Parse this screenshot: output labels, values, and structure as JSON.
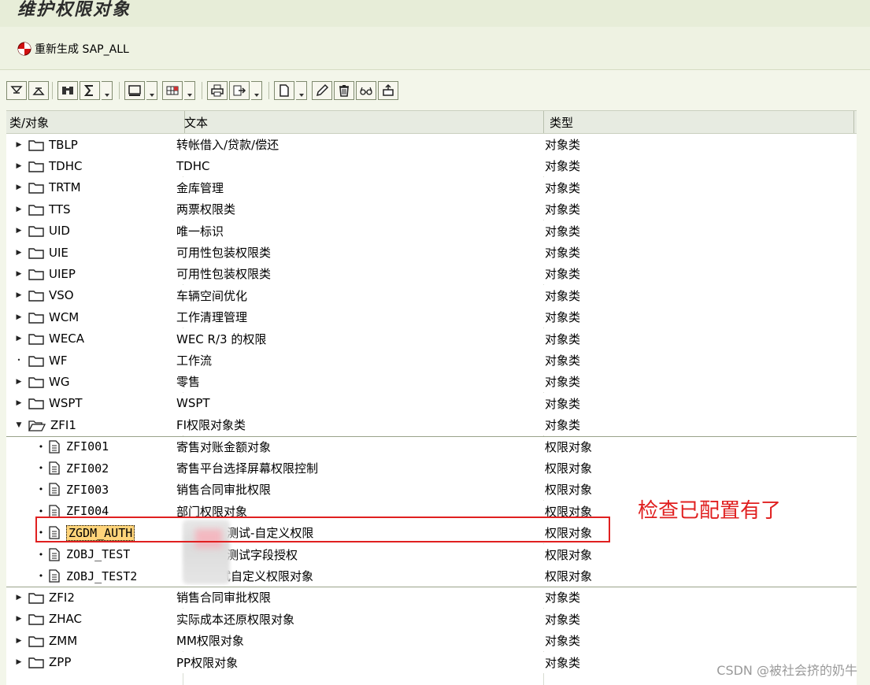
{
  "window": {
    "title": "维护权限对象"
  },
  "app_toolbar": {
    "regenerate_label": "重新生成 SAP_ALL"
  },
  "columns": {
    "class_object": "类/对象",
    "text": "文本",
    "type": "类型"
  },
  "rows": [
    {
      "kind": "class",
      "expander": "collapsed",
      "name": "TBLP",
      "text": "转帐借入/贷款/偿还",
      "type": "对象类"
    },
    {
      "kind": "class",
      "expander": "collapsed",
      "name": "TDHC",
      "text": "TDHC",
      "type": "对象类"
    },
    {
      "kind": "class",
      "expander": "collapsed",
      "name": "TRTM",
      "text": "金库管理",
      "type": "对象类"
    },
    {
      "kind": "class",
      "expander": "collapsed",
      "name": "TTS",
      "text": "两票权限类",
      "type": "对象类"
    },
    {
      "kind": "class",
      "expander": "collapsed",
      "name": "UID",
      "text": "唯一标识",
      "type": "对象类"
    },
    {
      "kind": "class",
      "expander": "collapsed",
      "name": "UIE",
      "text": "可用性包装权限类",
      "type": "对象类"
    },
    {
      "kind": "class",
      "expander": "collapsed",
      "name": "UIEP",
      "text": "可用性包装权限类",
      "type": "对象类"
    },
    {
      "kind": "class",
      "expander": "collapsed",
      "name": "VSO",
      "text": "车辆空间优化",
      "type": "对象类"
    },
    {
      "kind": "class",
      "expander": "collapsed",
      "name": "WCM",
      "text": "工作清理管理",
      "type": "对象类"
    },
    {
      "kind": "class",
      "expander": "collapsed",
      "name": "WECA",
      "text": "WEC R/3 的权限",
      "type": "对象类"
    },
    {
      "kind": "class",
      "expander": "leaf",
      "name": "WF",
      "text": "工作流",
      "type": "对象类"
    },
    {
      "kind": "class",
      "expander": "collapsed",
      "name": "WG",
      "text": "零售",
      "type": "对象类"
    },
    {
      "kind": "class",
      "expander": "collapsed",
      "name": "WSPT",
      "text": "WSPT",
      "type": "对象类"
    },
    {
      "kind": "class",
      "expander": "expanded",
      "name": "ZFI1",
      "text": "FI权限对象类",
      "type": "对象类"
    },
    {
      "kind": "object",
      "name": "ZFI001",
      "text": "寄售对账金额对象",
      "type": "权限对象"
    },
    {
      "kind": "object",
      "name": "ZFI002",
      "text": "寄售平台选择屏幕权限控制",
      "type": "权限对象"
    },
    {
      "kind": "object",
      "name": "ZFI003",
      "text": "销售合同审批权限",
      "type": "权限对象"
    },
    {
      "kind": "object",
      "name": "ZFI004",
      "text": "部门权限对象",
      "type": "权限对象"
    },
    {
      "kind": "object",
      "name": "ZGDM_AUTH",
      "text": "测试-自定义权限",
      "type": "权限对象",
      "selected": true
    },
    {
      "kind": "object",
      "name": "ZOBJ_TEST",
      "text": "测试字段授权",
      "type": "权限对象"
    },
    {
      "kind": "object",
      "name": "ZOBJ_TEST2",
      "text": "试自定义权限对象",
      "type": "权限对象"
    },
    {
      "kind": "class",
      "expander": "collapsed",
      "name": "ZFI2",
      "text": "销售合同审批权限",
      "type": "对象类"
    },
    {
      "kind": "class",
      "expander": "collapsed",
      "name": "ZHAC",
      "text": "实际成本还原权限对象",
      "type": "对象类"
    },
    {
      "kind": "class",
      "expander": "collapsed",
      "name": "ZMM",
      "text": "MM权限对象",
      "type": "对象类"
    },
    {
      "kind": "class",
      "expander": "collapsed",
      "name": "ZPP",
      "text": "PP权限对象",
      "type": "对象类"
    }
  ],
  "annotation": {
    "text": "检查已配置有了",
    "color": "#e02020"
  },
  "watermark": "CSDN @被社会挤的奶牛"
}
